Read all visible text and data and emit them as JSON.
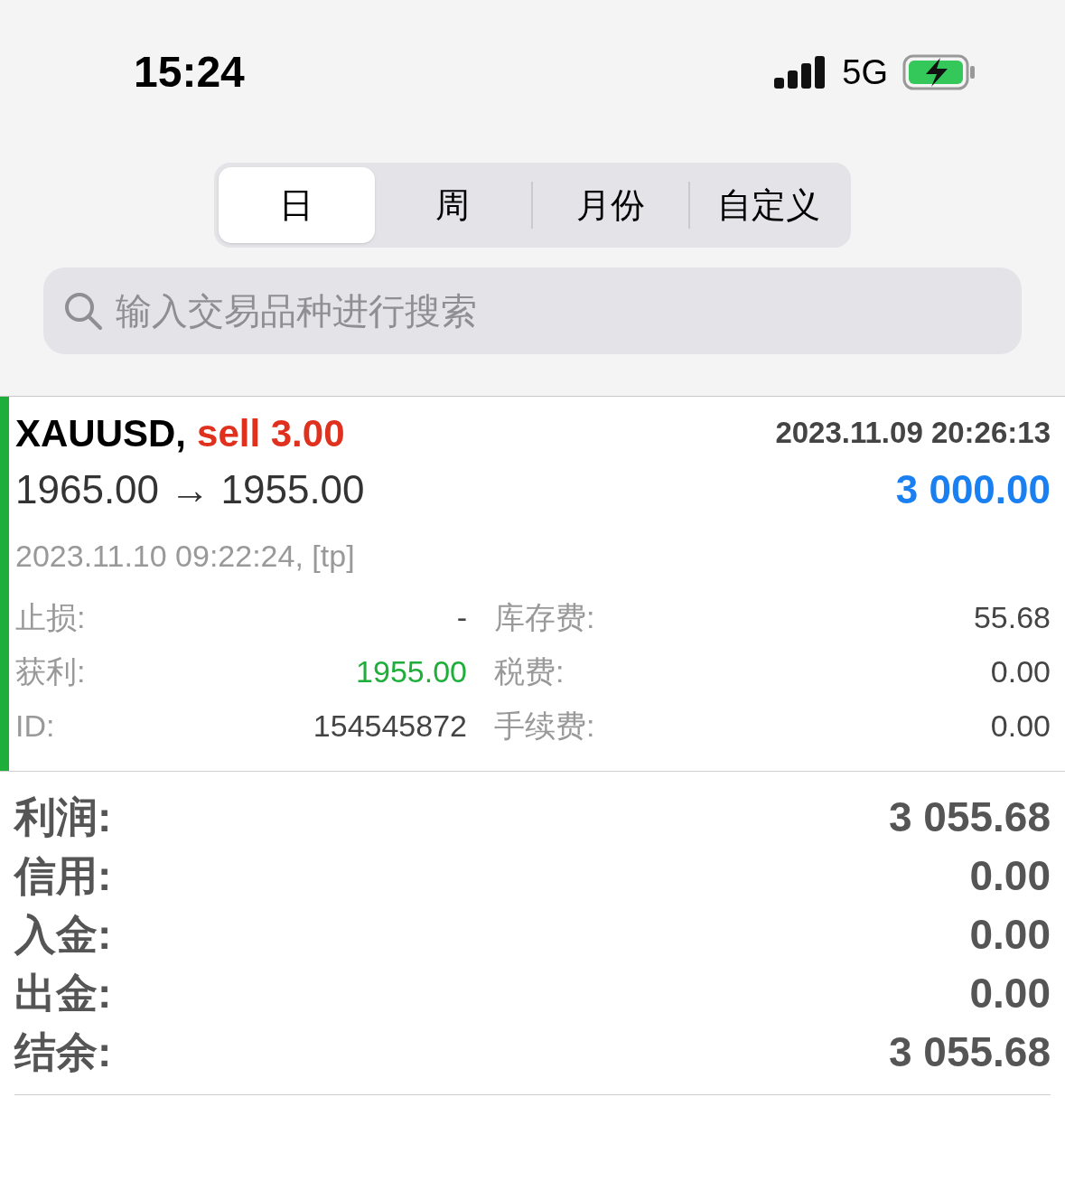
{
  "status_bar": {
    "time": "15:24",
    "network": "5G"
  },
  "tabs": [
    {
      "label": "日",
      "selected": true
    },
    {
      "label": "周",
      "selected": false
    },
    {
      "label": "月份",
      "selected": false
    },
    {
      "label": "自定义",
      "selected": false
    }
  ],
  "search": {
    "placeholder": "输入交易品种进行搜索"
  },
  "trade": {
    "symbol": "XAUUSD,",
    "side": "sell 3.00",
    "open_time": "2023.11.09 20:26:13",
    "prices": "1965.00 → 1955.00",
    "profit": "3 000.00",
    "close_info": "2023.11.10 09:22:24, [tp]",
    "left_details": [
      {
        "label": "止损:",
        "value": "-",
        "color": "#444444"
      },
      {
        "label": "获利:",
        "value": "1955.00",
        "color": "#1fae3a"
      },
      {
        "label": "ID:",
        "value": "154545872",
        "color": "#444444"
      }
    ],
    "right_details": [
      {
        "label": "库存费:",
        "value": "55.68"
      },
      {
        "label": "税费:",
        "value": "0.00"
      },
      {
        "label": "手续费:",
        "value": "0.00"
      }
    ]
  },
  "summary": [
    {
      "label": "利润:",
      "value": "3 055.68"
    },
    {
      "label": "信用:",
      "value": "0.00"
    },
    {
      "label": "入金:",
      "value": "0.00"
    },
    {
      "label": "出金:",
      "value": "0.00"
    },
    {
      "label": "结余:",
      "value": "3 055.68"
    }
  ]
}
